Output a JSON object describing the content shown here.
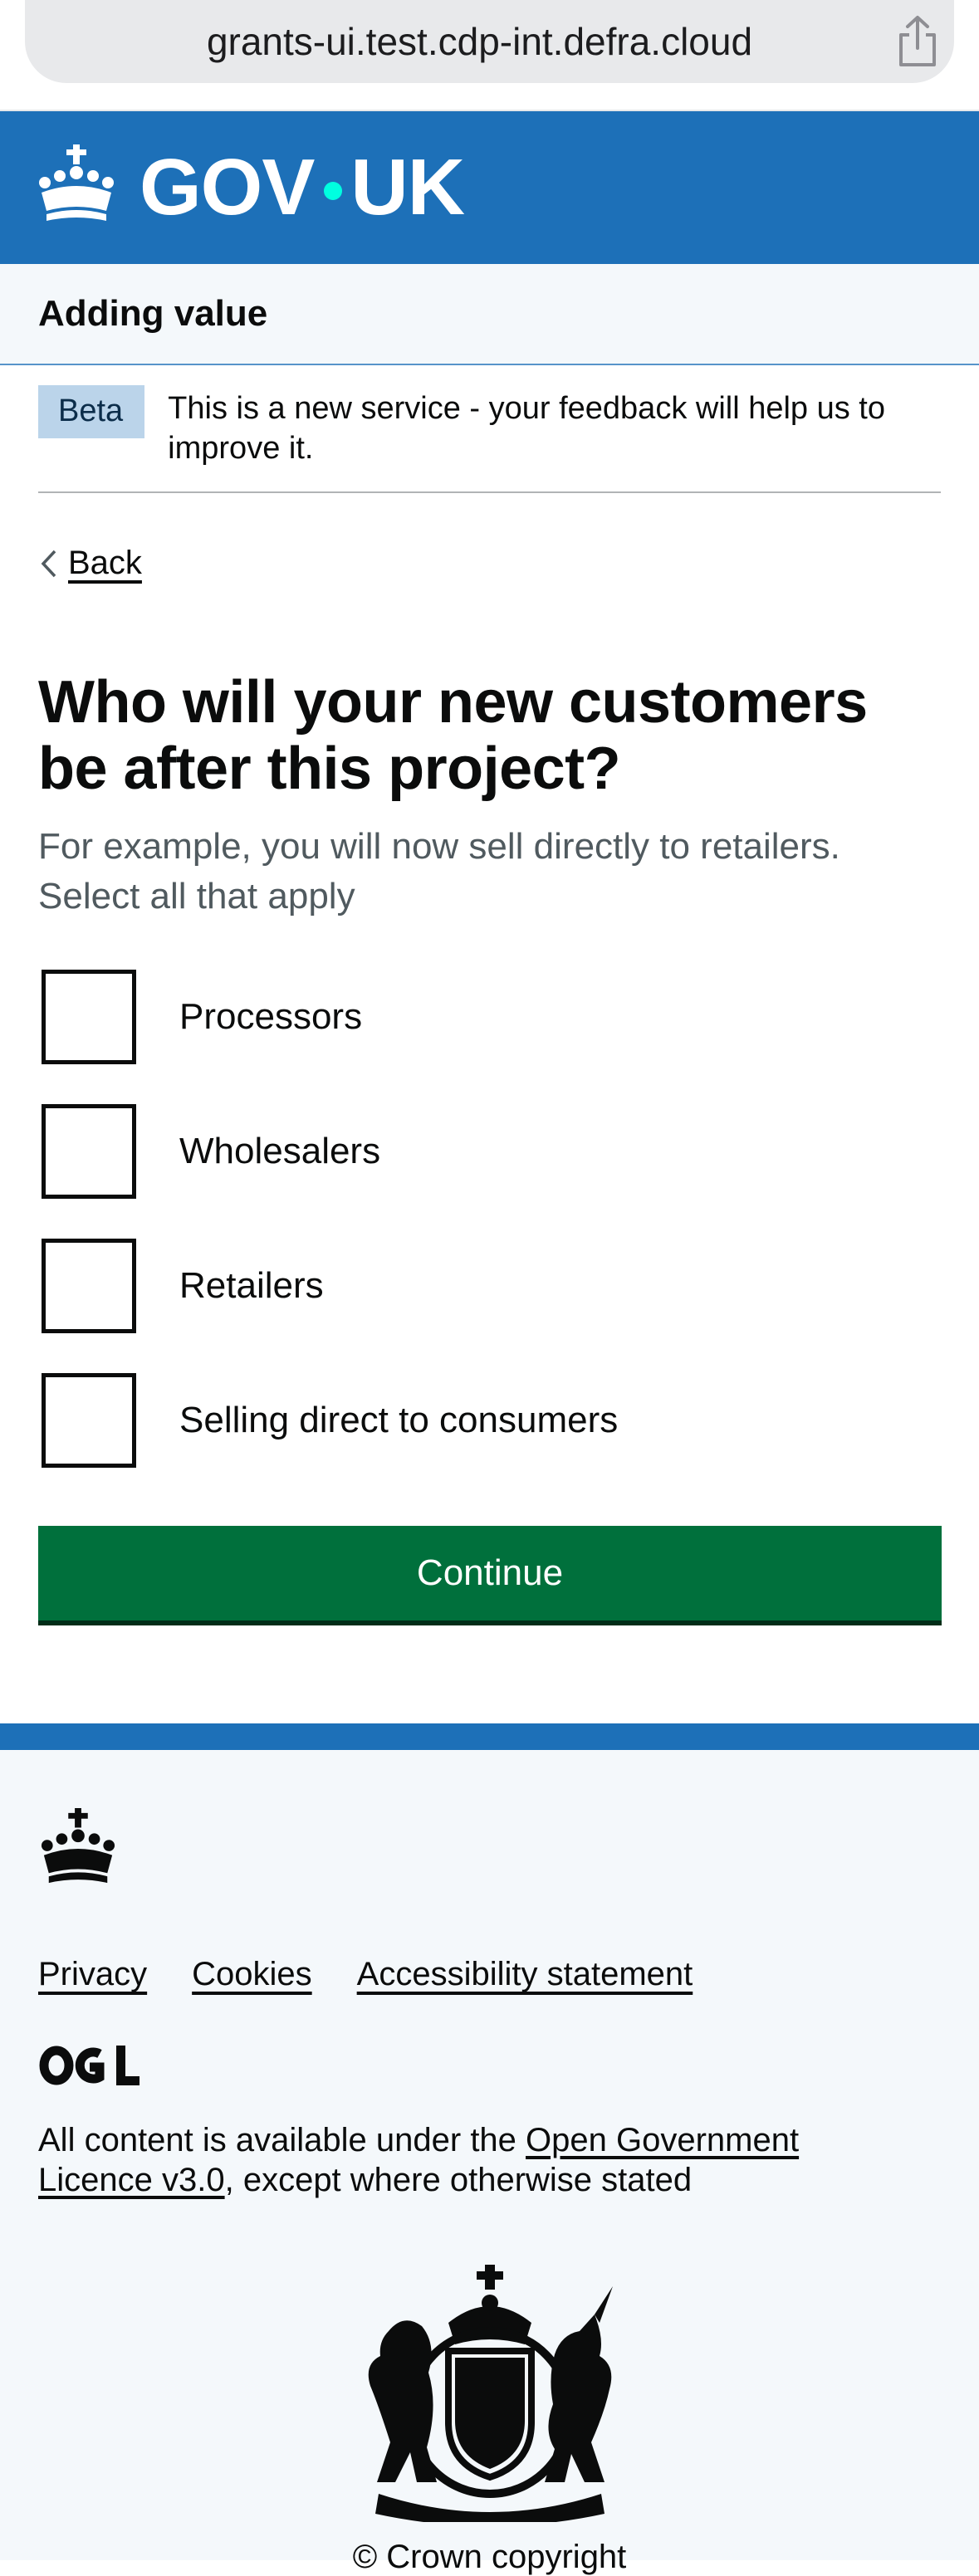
{
  "browser": {
    "url": "grants-ui.test.cdp-int.defra.cloud",
    "share_icon": "share-icon"
  },
  "header": {
    "logo_text_left": "GOV",
    "logo_text_right": "UK",
    "brand_color": "#1d70b8",
    "crown_icon": "crown-icon"
  },
  "service": {
    "name": "Adding value"
  },
  "phase_banner": {
    "tag": "Beta",
    "text": "This is a new service - your feedback will help us to improve it."
  },
  "back_link": {
    "label": "Back",
    "icon": "chevron-left-icon"
  },
  "form": {
    "question": "Who will your new customers be after this project?",
    "hint_line1": "For example, you will now sell directly to retailers.",
    "hint_line2": "Select all that apply",
    "options": [
      {
        "label": "Processors",
        "checked": false
      },
      {
        "label": "Wholesalers",
        "checked": false
      },
      {
        "label": "Retailers",
        "checked": false
      },
      {
        "label": "Selling direct to consumers",
        "checked": false
      }
    ],
    "continue_label": "Continue",
    "button_color": "#00703c"
  },
  "footer": {
    "links": [
      "Privacy",
      "Cookies",
      "Accessibility statement"
    ],
    "licence_prefix": "All content is available under the ",
    "licence_link": "Open Government Licence v3.0",
    "licence_suffix": ", except where otherwise stated",
    "copyright": "© Crown copyright",
    "ogl_icon": "ogl-logo-icon",
    "coat_of_arms_icon": "royal-coat-of-arms-icon"
  }
}
